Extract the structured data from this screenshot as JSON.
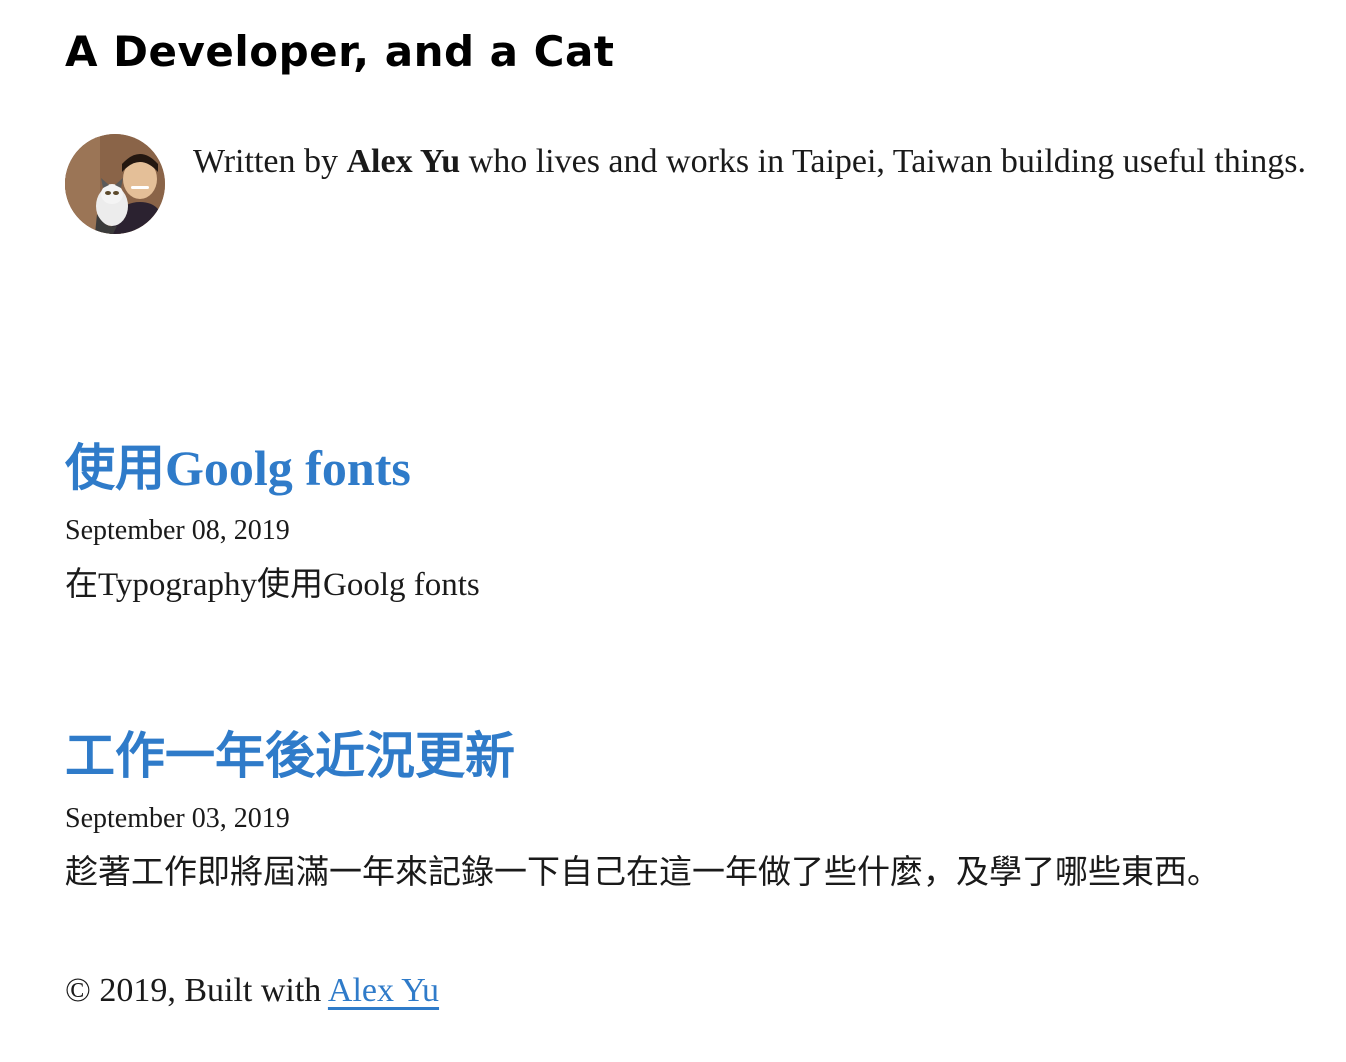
{
  "site": {
    "title": "A Developer, and a Cat"
  },
  "bio": {
    "prefix": "Written by ",
    "author": "Alex Yu",
    "suffix": " who lives and works in Taipei, Taiwan building useful things.",
    "avatar_icon": "author-avatar-photo"
  },
  "posts": [
    {
      "title": "使用Goolg fonts",
      "date": "September 08, 2019",
      "excerpt": "在Typography使用Goolg fonts"
    },
    {
      "title": "工作一年後近況更新",
      "date": "September 03, 2019",
      "excerpt": "趁著工作即將屆滿一年來記錄一下自己在這一年做了些什麼，及學了哪些東西。"
    }
  ],
  "footer": {
    "prefix": "© 2019, Built with ",
    "link_label": "Alex Yu"
  },
  "colors": {
    "link": "#2f7bc9",
    "text": "#1a1a1a"
  }
}
